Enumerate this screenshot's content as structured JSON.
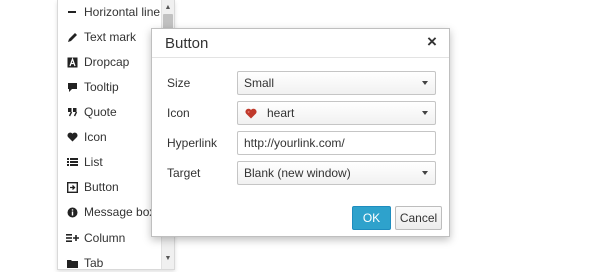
{
  "menu": {
    "items": [
      {
        "label": "Horizontal line",
        "icon": "horizontal-line-icon"
      },
      {
        "label": "Text mark",
        "icon": "pencil-icon"
      },
      {
        "label": "Dropcap",
        "icon": "dropcap-icon"
      },
      {
        "label": "Tooltip",
        "icon": "speech-bubble-icon"
      },
      {
        "label": "Quote",
        "icon": "quote-icon"
      },
      {
        "label": "Icon",
        "icon": "heart-icon"
      },
      {
        "label": "List",
        "icon": "list-icon"
      },
      {
        "label": "Button",
        "icon": "button-icon"
      },
      {
        "label": "Message box",
        "icon": "info-icon"
      },
      {
        "label": "Column",
        "icon": "column-icon"
      },
      {
        "label": "Tab",
        "icon": "folder-icon"
      }
    ]
  },
  "dialog": {
    "title": "Button",
    "close_glyph": "×",
    "fields": {
      "size": {
        "label": "Size",
        "value": "Small"
      },
      "icon": {
        "label": "Icon",
        "value": "heart"
      },
      "hyperlink": {
        "label": "Hyperlink",
        "value": "http://yourlink.com/"
      },
      "target": {
        "label": "Target",
        "value": "Blank (new window)"
      }
    },
    "ok_label": "OK",
    "cancel_label": "Cancel"
  },
  "colors": {
    "ok_button": "#2ea2cc",
    "heart": "#c0392b"
  }
}
